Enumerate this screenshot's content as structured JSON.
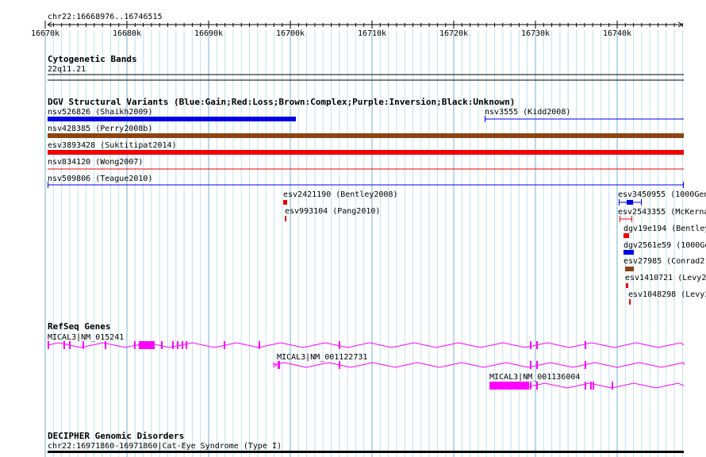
{
  "region": {
    "label": "chr22:16668976..16746515"
  },
  "ruler": {
    "ticks": [
      "16670k",
      "16680k",
      "16690k",
      "16700k",
      "16710k",
      "16720k",
      "16730k",
      "16740k"
    ]
  },
  "tracks": {
    "cytoband": {
      "title": "Cytogenetic Bands",
      "band": "22q11.21"
    },
    "dgv": {
      "title": "DGV Structural Variants (Blue:Gain;Red:Loss;Brown:Complex;Purple:Inversion;Black:Unknown)",
      "features": [
        {
          "label": "nsv526826 (Shaikh2009)",
          "color": "#0000e6",
          "type": "gain"
        },
        {
          "label": "nsv3555 (Kidd2008)",
          "color": "#0000e6",
          "type": "gain"
        },
        {
          "label": "nsv428385 (Perry2008b)",
          "color": "#8b4513",
          "type": "complex"
        },
        {
          "label": "esv3893428 (Suktitipat2014)",
          "color": "#ee0000",
          "type": "loss"
        },
        {
          "label": "nsv834120 (Wong2007)",
          "color": "#ee0000",
          "type": "loss"
        },
        {
          "label": "nsv509806 (Teague2010)",
          "color": "#0000e6",
          "type": "gain"
        },
        {
          "label": "esv2421190 (Bentley2008)",
          "color": "#ee0000",
          "type": "loss"
        },
        {
          "label": "esv993104 (Pang2010)",
          "color": "#ee0000",
          "type": "loss"
        },
        {
          "label": "esv3450955 (1000Gen",
          "color": "#0000e6",
          "type": "gain"
        },
        {
          "label": "esv2543355 (McKerna",
          "color": "#ee0000",
          "type": "loss"
        },
        {
          "label": "dgv19e194 (Bentley",
          "color": "#ee0000",
          "type": "loss"
        },
        {
          "label": "dgv2561e59 (1000Ge",
          "color": "#0000e6",
          "type": "gain"
        },
        {
          "label": "esv27985 (Conrad2",
          "color": "#8b4513",
          "type": "complex"
        },
        {
          "label": "esv1410721 (Levy2",
          "color": "#ee0000",
          "type": "loss"
        },
        {
          "label": "esv1048298 (Levy2",
          "color": "#ee0000",
          "type": "loss"
        }
      ]
    },
    "refseq": {
      "title": "RefSeq Genes",
      "color": "#ff00ff",
      "genes": [
        {
          "label": "MICAL3|NM_015241"
        },
        {
          "label": "MICAL3|NM_001122731"
        },
        {
          "label": "MICAL3|NM_001136004"
        }
      ]
    },
    "decipher": {
      "title": "DECIPHER Genomic Disorders",
      "feature": "chr22:16971860-16971860|Cat-Eye Syndrome (Type I)"
    }
  }
}
